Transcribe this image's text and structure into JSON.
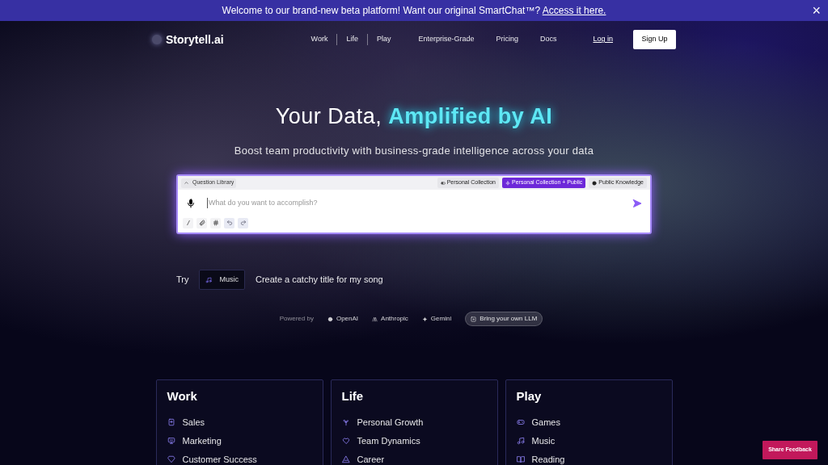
{
  "banner": {
    "text": "Welcome to our brand-new beta platform! Want our original SmartChat™? ",
    "link": "Access it here.",
    "close": "×"
  },
  "header": {
    "logo": "Storytell.ai",
    "nav_primary": [
      "Work",
      "Life",
      "Play"
    ],
    "nav_secondary": [
      "Enterprise-Grade",
      "Pricing",
      "Docs"
    ],
    "login": "Log in",
    "signup": "Sign Up"
  },
  "hero": {
    "title_plain": "Your Data, ",
    "title_accent": "Amplified by AI",
    "subtitle": "Boost team productivity with business-grade intelligence across your data"
  },
  "chat": {
    "library": "Question Library",
    "modes": [
      {
        "label": "Personal Collection",
        "kind": "personal",
        "selected": false
      },
      {
        "label": "Personal Collection + Public",
        "kind": "both",
        "selected": true
      },
      {
        "label": "Public Knowledge",
        "kind": "public",
        "selected": false
      }
    ],
    "placeholder": "What do you want to accomplish?"
  },
  "try": {
    "label": "Try",
    "chip": "Music",
    "prompt": "Create a catchy title for my song"
  },
  "powered": {
    "label": "Powered by",
    "providers": [
      {
        "name": "OpenAI",
        "kind": "openai"
      },
      {
        "name": "Anthropic",
        "kind": "anthropic"
      },
      {
        "name": "Gemini",
        "kind": "gemini"
      }
    ],
    "byo": "Bring your own LLM"
  },
  "categories": [
    {
      "title": "Work",
      "items": [
        "Sales",
        "Marketing",
        "Customer Success"
      ]
    },
    {
      "title": "Life",
      "items": [
        "Personal Growth",
        "Team Dynamics",
        "Career"
      ]
    },
    {
      "title": "Play",
      "items": [
        "Games",
        "Music",
        "Reading"
      ]
    }
  ],
  "feedback": "Share Feedback"
}
